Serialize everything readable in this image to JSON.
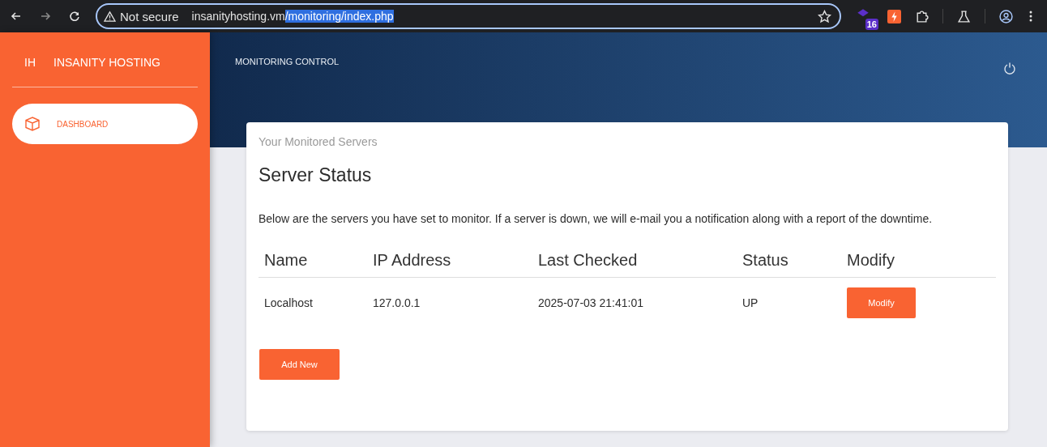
{
  "browser": {
    "security": "Not secure",
    "url_host": "insanityhosting.vm",
    "url_path": "/monitoring/index.php",
    "url_path_selected": true,
    "extension_badge": "16"
  },
  "sidebar": {
    "logo_short": "IH",
    "logo_text": "INSANITY HOSTING",
    "items": [
      {
        "label": "DASHBOARD",
        "selected": true
      }
    ]
  },
  "header": {
    "title": "MONITORING CONTROL"
  },
  "card": {
    "category": "Your Monitored Servers",
    "title": "Server Status",
    "description": "Below are the servers you have set to monitor. If a server is down, we will e-mail you a notification along with a report of the downtime.",
    "table": {
      "columns": [
        "Name",
        "IP Address",
        "Last Checked",
        "Status",
        "Modify"
      ],
      "rows": [
        {
          "name": "Localhost",
          "ip": "127.0.0.1",
          "last_checked": "2025-07-03 21:41:01",
          "status": "UP",
          "action": "Modify"
        }
      ]
    },
    "add_button": "Add New"
  }
}
